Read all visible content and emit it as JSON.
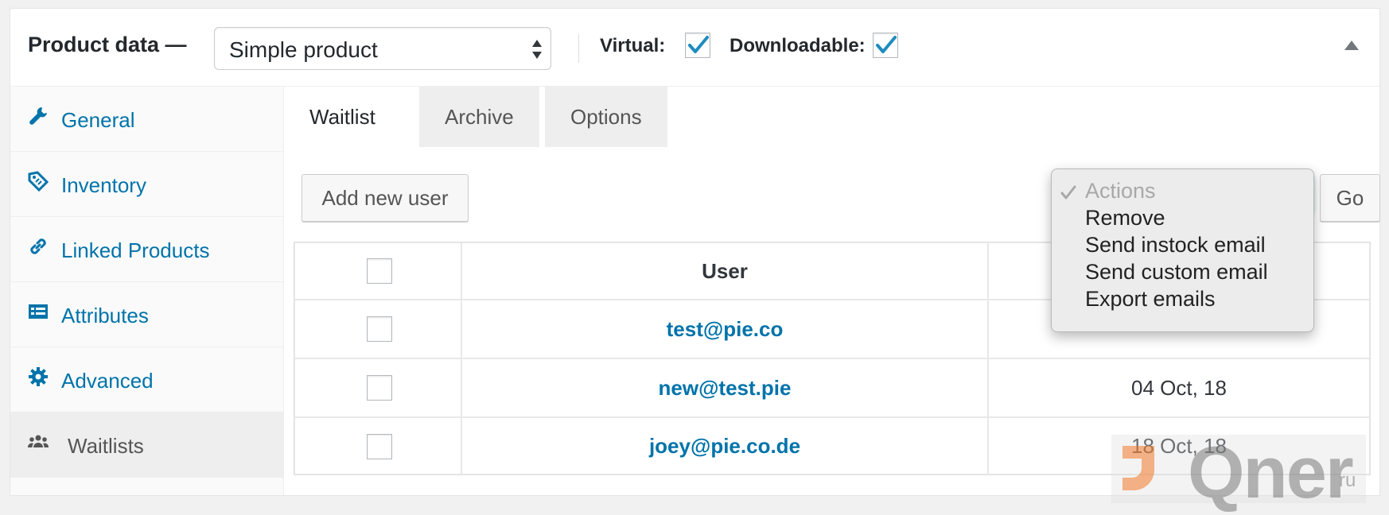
{
  "header": {
    "title": "Product data —",
    "product_type": "Simple product",
    "virtual_label": "Virtual:",
    "virtual_checked": true,
    "downloadable_label": "Downloadable:",
    "downloadable_checked": true
  },
  "sidebar": {
    "items": [
      {
        "label": "General",
        "icon": "wrench-icon"
      },
      {
        "label": "Inventory",
        "icon": "tag-icon"
      },
      {
        "label": "Linked Products",
        "icon": "link-icon"
      },
      {
        "label": "Attributes",
        "icon": "list-icon"
      },
      {
        "label": "Advanced",
        "icon": "gear-icon"
      },
      {
        "label": "Waitlists",
        "icon": "users-icon"
      }
    ],
    "active": "Waitlists"
  },
  "tabs": [
    {
      "label": "Waitlist",
      "active": true
    },
    {
      "label": "Archive",
      "active": false
    },
    {
      "label": "Options",
      "active": false
    }
  ],
  "toolbar": {
    "add_user_label": "Add new user",
    "go_label": "Go"
  },
  "actions_menu": {
    "items": [
      "Actions",
      "Remove",
      "Send instock email",
      "Send custom email",
      "Export emails"
    ],
    "selected": "Actions"
  },
  "table": {
    "header_user": "User",
    "rows": [
      {
        "email": "test@pie.co",
        "date": ""
      },
      {
        "email": "new@test.pie",
        "date": "04 Oct, 18"
      },
      {
        "email": "joey@pie.co.de",
        "date": "18 Oct, 18"
      }
    ]
  },
  "watermark": {
    "text": "Qner",
    "suffix": "ru"
  },
  "colors": {
    "link": "#0073aa",
    "focus": "#5b9dd9",
    "check": "#1e8cbe"
  }
}
